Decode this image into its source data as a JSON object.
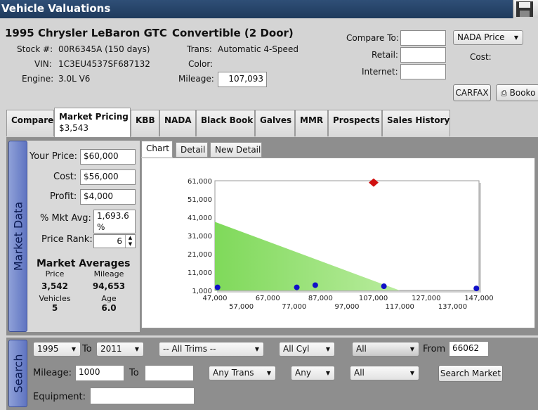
{
  "window": {
    "title": "Vehicle Valuations"
  },
  "vehicle": {
    "year_make_model": "1995 Chrysler LeBaron GTC",
    "body": "Convertible (2 Door)",
    "stock_label": "Stock #:",
    "stock_value": "00R6345A (150 days)",
    "vin_label": "VIN:",
    "vin_value": "1C3EU4537SF687132",
    "engine_label": "Engine:",
    "engine_value": "3.0L V6",
    "trans_label": "Trans:",
    "trans_value": "Automatic 4-Speed",
    "color_label": "Color:",
    "color_value": "",
    "mileage_label": "Mileage:",
    "mileage_value": "107,093"
  },
  "compare": {
    "compare_to_label": "Compare To:",
    "retail_label": "Retail:",
    "internet_label": "Internet:",
    "compare_to_value": "",
    "retail_value": "",
    "internet_value": "",
    "source_select": "NADA Price",
    "cost_label": "Cost:",
    "carfax_button": "CARFAX",
    "bookout_button": "Booko"
  },
  "tabs": [
    {
      "label": "Compare",
      "sub": ""
    },
    {
      "label": "Market Pricing",
      "sub": "$3,543"
    },
    {
      "label": "KBB",
      "sub": ""
    },
    {
      "label": "NADA",
      "sub": ""
    },
    {
      "label": "Black Book",
      "sub": ""
    },
    {
      "label": "Galves",
      "sub": ""
    },
    {
      "label": "MMR",
      "sub": ""
    },
    {
      "label": "Prospects",
      "sub": ""
    },
    {
      "label": "Sales History",
      "sub": ""
    }
  ],
  "market_data": {
    "section_label": "Market Data",
    "your_price_label": "Your Price:",
    "your_price_value": "$60,000",
    "cost_label": "Cost:",
    "cost_value": "$56,000",
    "profit_label": "Profit:",
    "profit_value": "$4,000",
    "mkt_avg_label": "% Mkt Avg:",
    "mkt_avg_value": "1,693.6 %",
    "price_rank_label": "Price Rank:",
    "price_rank_value": "6",
    "averages_title": "Market Averages",
    "price_label": "Price",
    "price_value": "3,542",
    "mileage_label": "Mileage",
    "mileage_value": "94,653",
    "vehicles_label": "Vehicles",
    "vehicles_value": "5",
    "age_label": "Age",
    "age_value": "6.0"
  },
  "chart_tabs": [
    "Chart",
    "Detail",
    "New Detail"
  ],
  "chart_data": {
    "type": "scatter",
    "x_ticks_top": [
      "47,000",
      "67,000",
      "87,000",
      "107,000",
      "127,000",
      "147,000"
    ],
    "x_ticks_bottom": [
      "57,000",
      "77,000",
      "97,000",
      "117,000",
      "137,000"
    ],
    "y_ticks": [
      "61,000",
      "51,000",
      "41,000",
      "31,000",
      "21,000",
      "11,000",
      "1,000"
    ],
    "xlim": [
      47000,
      147000
    ],
    "ylim": [
      1000,
      61000
    ],
    "trend_area": {
      "x": [
        47000,
        117000
      ],
      "y": [
        38500,
        1000
      ],
      "color": "#8fdd6f"
    },
    "series": [
      {
        "color": "#1010c8",
        "points": [
          [
            48000,
            2700
          ],
          [
            78000,
            2700
          ],
          [
            85000,
            3900
          ],
          [
            111000,
            3300
          ],
          [
            146000,
            2100
          ]
        ]
      }
    ],
    "your_vehicle": {
      "x": 107093,
      "y": 60000,
      "color": "#d01010"
    }
  },
  "search": {
    "section_label": "Search",
    "year_from": "1995",
    "to_label": "To",
    "year_to": "2011",
    "trims": "-- All Trims --",
    "cyl": "All Cyl",
    "all1": "All",
    "from_label": "From",
    "zip": "66062",
    "mileage_label": "Mileage:",
    "mileage_from": "1000",
    "mileage_to_label": "To",
    "mileage_to": "",
    "trans": "Any Trans",
    "any": "Any",
    "all2": "All",
    "search_button": "Search Market",
    "equipment_label": "Equipment:",
    "equipment_value": ""
  }
}
